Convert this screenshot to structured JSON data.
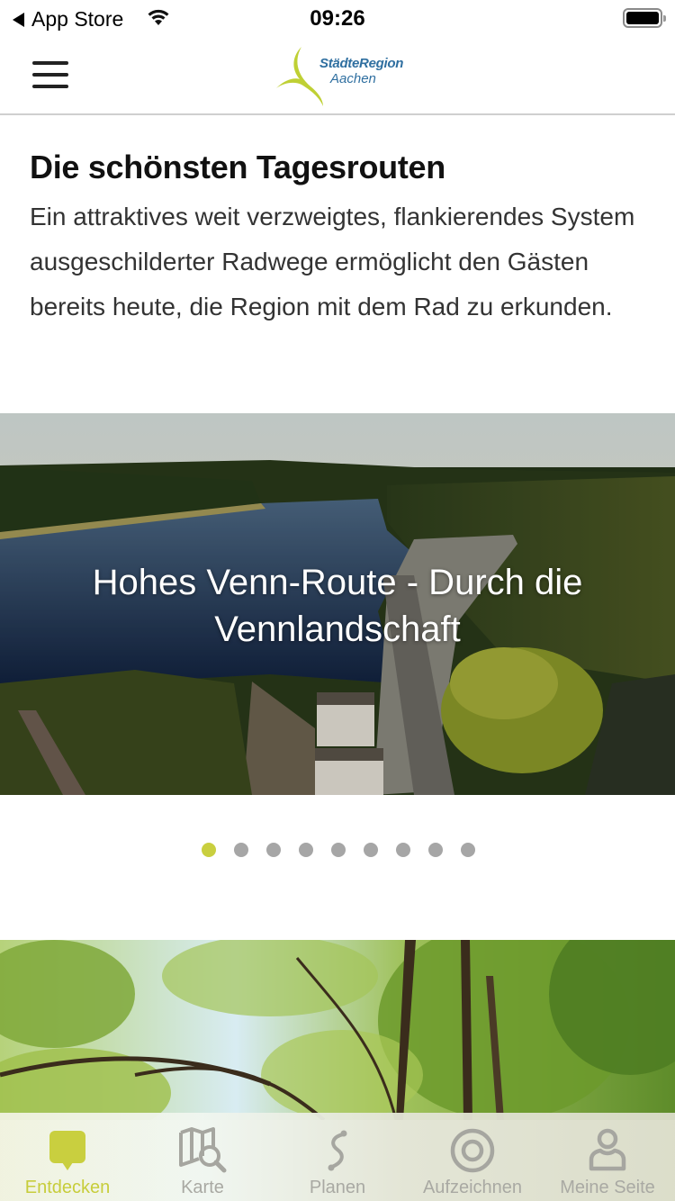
{
  "status_bar": {
    "back_label": "App Store",
    "time": "09:26",
    "wifi_icon": "wifi-icon",
    "battery_icon": "battery-full-icon"
  },
  "header": {
    "menu_icon": "hamburger-menu-icon",
    "logo_line1": "StädteRegion",
    "logo_line2": "Aachen"
  },
  "intro": {
    "title": "Die schönsten Tagesrouten",
    "body": "Ein attraktives weit verzweigtes, flankierendes System ausgeschilderter Radwege ermöglicht den Gästen bereits heute, die Region mit dem Rad zu erkunden."
  },
  "carousel": {
    "slides": [
      {
        "title": "Hohes Venn-Route - Durch die Vennlandschaft",
        "image": "reservoir-dam-aerial-photo"
      }
    ],
    "page_count": 9,
    "active_index": 0
  },
  "second_card": {
    "image": "forest-lake-trees-photo"
  },
  "colors": {
    "accent": "#c9cf3f",
    "inactive": "#a6a6a6",
    "logo_blue": "#2f6fa0"
  },
  "tab_bar": {
    "tabs": [
      {
        "label": "Entdecken",
        "icon": "discover-bubble-icon",
        "active": true
      },
      {
        "label": "Karte",
        "icon": "map-search-icon",
        "active": false
      },
      {
        "label": "Planen",
        "icon": "route-plan-icon",
        "active": false
      },
      {
        "label": "Aufzeichnen",
        "icon": "record-target-icon",
        "active": false
      },
      {
        "label": "Meine Seite",
        "icon": "user-profile-icon",
        "active": false
      }
    ]
  }
}
